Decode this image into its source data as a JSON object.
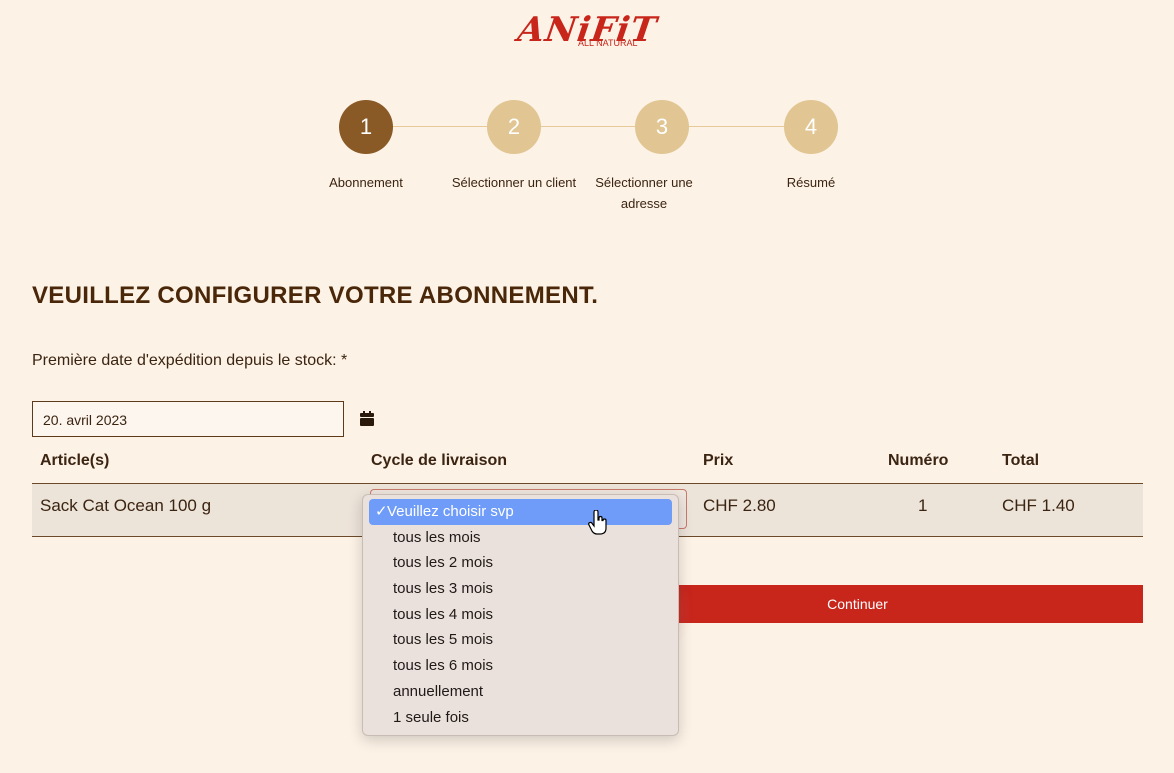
{
  "logo": {
    "text": "ANiFiT",
    "subtitle": "ALL NATURAL"
  },
  "steps": [
    {
      "number": "1",
      "label": "Abonnement"
    },
    {
      "number": "2",
      "label": "Sélectionner un client"
    },
    {
      "number": "3",
      "label": "Sélectionner une adresse"
    },
    {
      "number": "4",
      "label": "Résumé"
    }
  ],
  "page_title": "VEUILLEZ CONFIGURER VOTRE ABONNEMENT.",
  "date_field": {
    "label": "Première date d'expédition depuis le stock: *",
    "value": "20. avril 2023"
  },
  "table": {
    "headers": {
      "article": "Article(s)",
      "cycle": "Cycle de livraison",
      "price": "Prix",
      "number": "Numéro",
      "total": "Total"
    },
    "row": {
      "article": "Sack Cat Ocean 100 g",
      "price": "CHF 2.80",
      "number": "1",
      "total": "CHF 1.40"
    }
  },
  "cycle_dropdown": {
    "check": "✓",
    "options": [
      "Veuillez choisir svp",
      "tous les mois",
      "tous les 2 mois",
      "tous les 3 mois",
      "tous les 4 mois",
      "tous les 5 mois",
      "tous les 6 mois",
      "annuellement",
      "1 seule fois"
    ]
  },
  "continue_label": "Continuer",
  "colors": {
    "accent": "#c8251b",
    "step_active": "#8a5a26",
    "step_inactive": "#e1c592",
    "highlight": "#6f9cf8"
  }
}
